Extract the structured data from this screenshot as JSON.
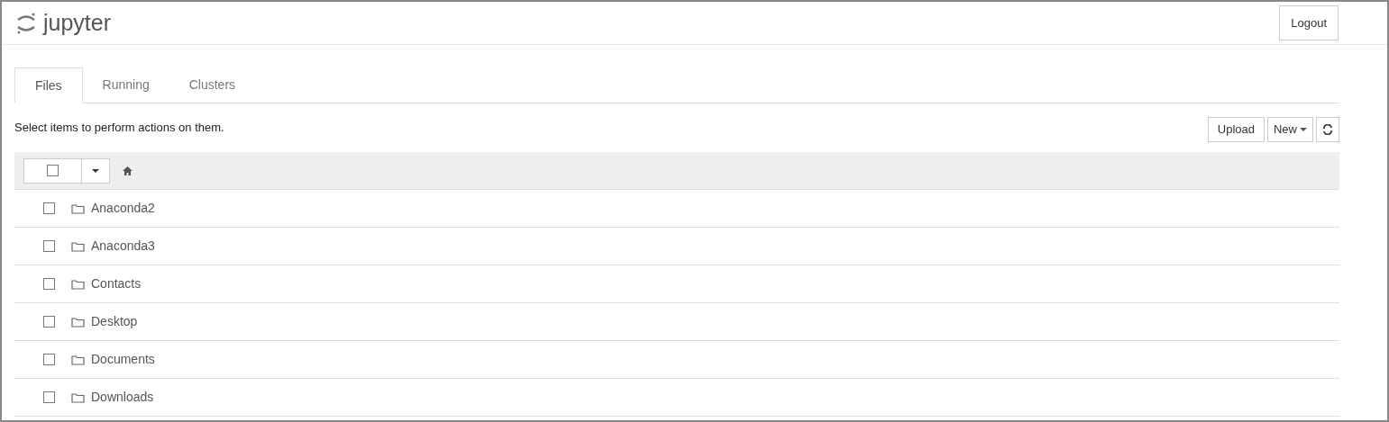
{
  "header": {
    "logo": "jupyter",
    "logout": "Logout"
  },
  "tabs": [
    {
      "label": "Files",
      "selected": true
    },
    {
      "label": "Running",
      "selected": false
    },
    {
      "label": "Clusters",
      "selected": false
    }
  ],
  "toolbar": {
    "hint": "Select items to perform actions on them.",
    "upload": "Upload",
    "new": "New"
  },
  "list_header": {
    "checked": false
  },
  "items": [
    {
      "name": "Anaconda2",
      "checked": false
    },
    {
      "name": "Anaconda3",
      "checked": false
    },
    {
      "name": "Contacts",
      "checked": false
    },
    {
      "name": "Desktop",
      "checked": false
    },
    {
      "name": "Documents",
      "checked": false
    },
    {
      "name": "Downloads",
      "checked": false
    }
  ]
}
